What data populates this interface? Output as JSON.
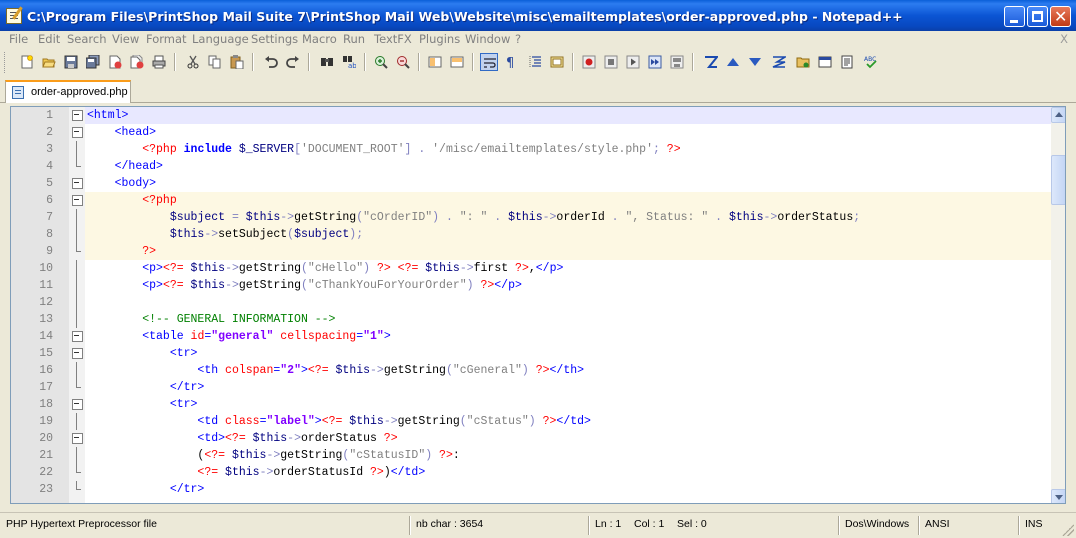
{
  "window": {
    "title": "C:\\Program Files\\PrintShop Mail Suite 7\\PrintShop Mail Web\\Website\\misc\\emailtemplates\\order-approved.php - Notepad++"
  },
  "menu": {
    "items": [
      "File",
      "Edit",
      "Search",
      "View",
      "Format",
      "Language",
      "Settings",
      "Macro",
      "Run",
      "TextFX",
      "Plugins",
      "Window",
      "?"
    ],
    "close_label": "X"
  },
  "toolbar": {
    "buttons": [
      "new-file-icon",
      "open-file-icon",
      "save-icon",
      "save-all-icon",
      "close-icon",
      "close-all-icon",
      "print-icon",
      "cut-icon",
      "copy-icon",
      "paste-icon",
      "undo-icon",
      "redo-icon",
      "find-icon",
      "replace-icon",
      "zoom-in-icon",
      "zoom-out-icon",
      "sync-vertical-icon",
      "sync-horizontal-icon",
      "word-wrap-icon",
      "show-all-chars-icon",
      "indent-guide-icon",
      "user-lang-icon",
      "record-macro-icon",
      "stop-record-icon",
      "play-macro-icon",
      "run-macro-multiple-icon",
      "save-macro-icon",
      "textfx-icon",
      "move-up-icon",
      "move-down-icon",
      "sort-icon",
      "folder-icon",
      "window-icon",
      "doc-map-icon",
      "spell-check-icon"
    ]
  },
  "tab": {
    "label": "order-approved.php"
  },
  "editor": {
    "lines": [
      {
        "n": "1"
      },
      {
        "n": "2"
      },
      {
        "n": "3"
      },
      {
        "n": "4"
      },
      {
        "n": "5"
      },
      {
        "n": "6"
      },
      {
        "n": "7"
      },
      {
        "n": "8"
      },
      {
        "n": "9"
      },
      {
        "n": "10"
      },
      {
        "n": "11"
      },
      {
        "n": "12"
      },
      {
        "n": "13"
      },
      {
        "n": "14"
      },
      {
        "n": "15"
      },
      {
        "n": "16"
      },
      {
        "n": "17"
      },
      {
        "n": "18"
      },
      {
        "n": "19"
      },
      {
        "n": "20"
      },
      {
        "n": "21"
      },
      {
        "n": "22"
      },
      {
        "n": "23"
      }
    ],
    "code": {
      "l1": [
        "<html>"
      ],
      "l2": [
        "<head>"
      ],
      "l3": [
        "<?php",
        " include",
        " $_SERVER",
        "[",
        "'DOCUMENT_ROOT'",
        "]",
        " .",
        " '/misc/emailtemplates/style.php'",
        ";",
        " ?>"
      ],
      "l4": [
        "</head>"
      ],
      "l5": [
        "<body>"
      ],
      "l6": [
        "<?php"
      ],
      "l7": [
        "$subject",
        " =",
        " $this",
        "->",
        "getString",
        "(",
        "\"cOrderID\"",
        ")",
        " .",
        " \": \"",
        " .",
        " $this",
        "->",
        "orderId",
        " .",
        " \", Status: \"",
        " .",
        " $this",
        "->",
        "orderStatus",
        ";"
      ],
      "l8": [
        "$this",
        "->",
        "setSubject",
        "(",
        "$subject",
        ")",
        ";"
      ],
      "l9": [
        "?>"
      ],
      "l10": [
        "<p>",
        "<?=",
        " $this",
        "->",
        "getString",
        "(",
        "\"cHello\"",
        ")",
        " ?>",
        " ",
        "<?=",
        " $this",
        "->",
        "first",
        " ?>",
        ",",
        "</p>"
      ],
      "l11": [
        "<p>",
        "<?=",
        " $this",
        "->",
        "getString",
        "(",
        "\"cThankYouForYourOrder\"",
        ")",
        " ?>",
        "</p>"
      ],
      "l12": [
        ""
      ],
      "l13": [
        "<!-- GENERAL INFORMATION -->"
      ],
      "l14": [
        "<table",
        " id",
        "=",
        "\"general\"",
        " cellspacing",
        "=",
        "\"1\"",
        ">"
      ],
      "l15": [
        "<tr>"
      ],
      "l16": [
        "<th",
        " colspan",
        "=",
        "\"2\"",
        ">",
        "<?=",
        " $this",
        "->",
        "getString",
        "(",
        "\"cGeneral\"",
        ")",
        " ?>",
        "</th>"
      ],
      "l17": [
        "</tr>"
      ],
      "l18": [
        "<tr>"
      ],
      "l19": [
        "<td",
        " class",
        "=",
        "\"label\"",
        ">",
        "<?=",
        " $this",
        "->",
        "getString",
        "(",
        "\"cStatus\"",
        ")",
        " ?>",
        "</td>"
      ],
      "l20": [
        "<td>",
        "<?=",
        " $this",
        "->",
        "orderStatus",
        " ?>"
      ],
      "l21": [
        "(",
        "<?=",
        " $this",
        "->",
        "getString",
        "(",
        "\"cStatusID\"",
        ")",
        " ?>",
        ":"
      ],
      "l22": [
        "<?=",
        " $this",
        "->",
        "orderStatusId",
        " ?>",
        ")",
        "</td>"
      ],
      "l23": [
        "</tr>"
      ]
    }
  },
  "status": {
    "file_type": "PHP Hypertext Preprocessor file",
    "nb_char": "nb char : 3654",
    "ln": "Ln : 1",
    "col": "Col : 1",
    "sel": "Sel : 0",
    "eol": "Dos\\Windows",
    "encoding": "ANSI",
    "mode": "INS"
  },
  "colors": {
    "title_bar": "#0b55d4",
    "current_line": "#e8e8ff",
    "php_block": "#fdf8e3",
    "html_tag": "#0000ff",
    "html_attr": "#ff0000",
    "html_string": "#8000ff",
    "php_variable": "#000080",
    "php_string": "#808080",
    "comment": "#008000"
  }
}
